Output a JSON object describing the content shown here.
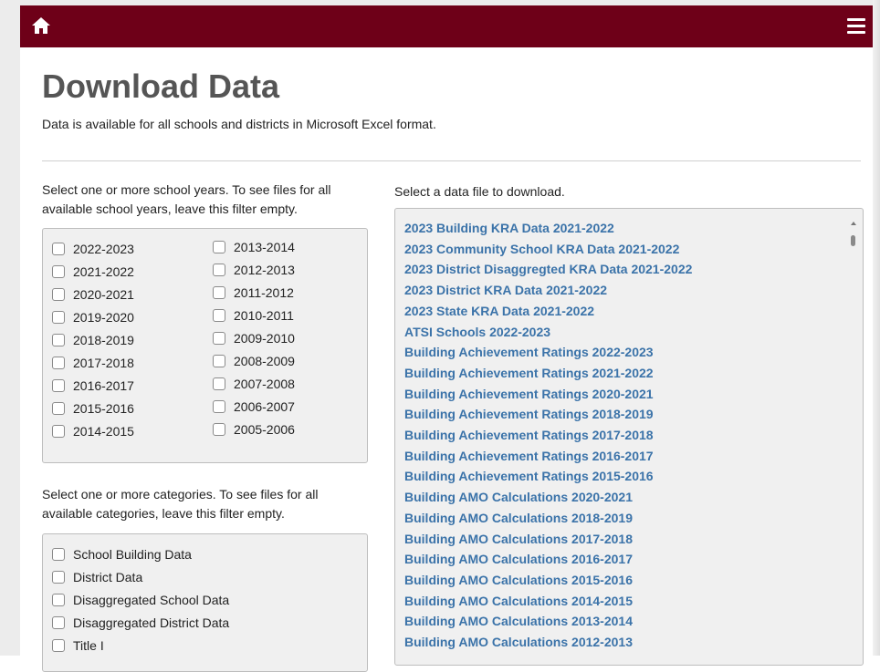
{
  "navbar": {
    "home_icon": "home-icon",
    "menu_icon": "hamburger-menu-icon",
    "color": "#6e0018"
  },
  "page": {
    "title": "Download Data",
    "subtitle": "Data is available for all schools and districts in Microsoft Excel format."
  },
  "years_filter": {
    "instruction_line1": "Select one or more school years. To see files for all",
    "instruction_line2": "available school years, leave this filter empty.",
    "left_column": [
      "2022-2023",
      "2021-2022",
      "2020-2021",
      "2019-2020",
      "2018-2019",
      "2017-2018",
      "2016-2017",
      "2015-2016",
      "2014-2015"
    ],
    "right_column": [
      "2013-2014",
      "2012-2013",
      "2011-2012",
      "2010-2011",
      "2009-2010",
      "2008-2009",
      "2007-2008",
      "2006-2007",
      "2005-2006"
    ]
  },
  "categories_filter": {
    "instruction_line1": "Select one or more categories. To see files for all",
    "instruction_line2": "available categories, leave this filter empty.",
    "items": [
      "School Building Data",
      "District Data",
      "Disaggregated School Data",
      "Disaggregated District Data",
      "Title I"
    ]
  },
  "files": {
    "label": "Select a data file to download.",
    "link_color": "#3b73a9",
    "items": [
      "2023 Building KRA Data 2021-2022",
      "2023 Community School KRA Data 2021-2022",
      "2023 District Disaggregted KRA Data 2021-2022",
      "2023 District KRA Data 2021-2022",
      "2023 State KRA Data 2021-2022",
      "ATSI Schools 2022-2023",
      "Building Achievement Ratings 2022-2023",
      "Building Achievement Ratings 2021-2022",
      "Building Achievement Ratings 2020-2021",
      "Building Achievement Ratings 2018-2019",
      "Building Achievement Ratings 2017-2018",
      "Building Achievement Ratings 2016-2017",
      "Building Achievement Ratings 2015-2016",
      "Building AMO Calculations 2020-2021",
      "Building AMO Calculations 2018-2019",
      "Building AMO Calculations 2017-2018",
      "Building AMO Calculations 2016-2017",
      "Building AMO Calculations 2015-2016",
      "Building AMO Calculations 2014-2015",
      "Building AMO Calculations 2013-2014",
      "Building AMO Calculations 2012-2013"
    ]
  }
}
